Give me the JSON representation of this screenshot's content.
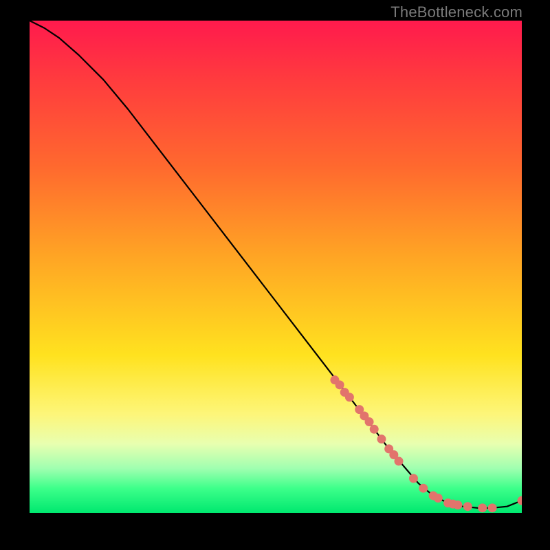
{
  "watermark": "TheBottleneck.com",
  "chart_data": {
    "type": "line",
    "title": "",
    "xlabel": "",
    "ylabel": "",
    "xlim": [
      0,
      100
    ],
    "ylim": [
      0,
      100
    ],
    "grid": false,
    "legend": false,
    "series": [
      {
        "name": "curve",
        "style": "line",
        "color": "#000000",
        "x": [
          0,
          3,
          6,
          10,
          15,
          20,
          25,
          30,
          35,
          40,
          45,
          50,
          55,
          60,
          65,
          70,
          73,
          76,
          79,
          82,
          85,
          88,
          91,
          94,
          97,
          100
        ],
        "y": [
          100,
          98.5,
          96.5,
          93.0,
          88.0,
          82.0,
          75.5,
          69.0,
          62.5,
          56.0,
          49.5,
          43.0,
          36.5,
          30.0,
          23.5,
          17.0,
          13.0,
          9.5,
          6.0,
          3.5,
          2.0,
          1.3,
          1.0,
          1.0,
          1.3,
          2.5
        ]
      },
      {
        "name": "dots",
        "style": "scatter",
        "color": "#e2746c",
        "x": [
          62,
          63,
          64,
          65,
          67,
          68,
          69,
          70,
          71.5,
          73,
          74,
          75,
          78,
          80,
          82,
          83,
          85,
          86,
          87,
          89,
          92,
          94,
          100
        ],
        "y": [
          27.0,
          26.0,
          24.5,
          23.5,
          21.0,
          19.7,
          18.5,
          17.0,
          15.0,
          13.0,
          11.8,
          10.5,
          7.0,
          5.0,
          3.5,
          3.0,
          2.0,
          1.8,
          1.6,
          1.3,
          1.0,
          1.0,
          2.5
        ]
      }
    ]
  }
}
